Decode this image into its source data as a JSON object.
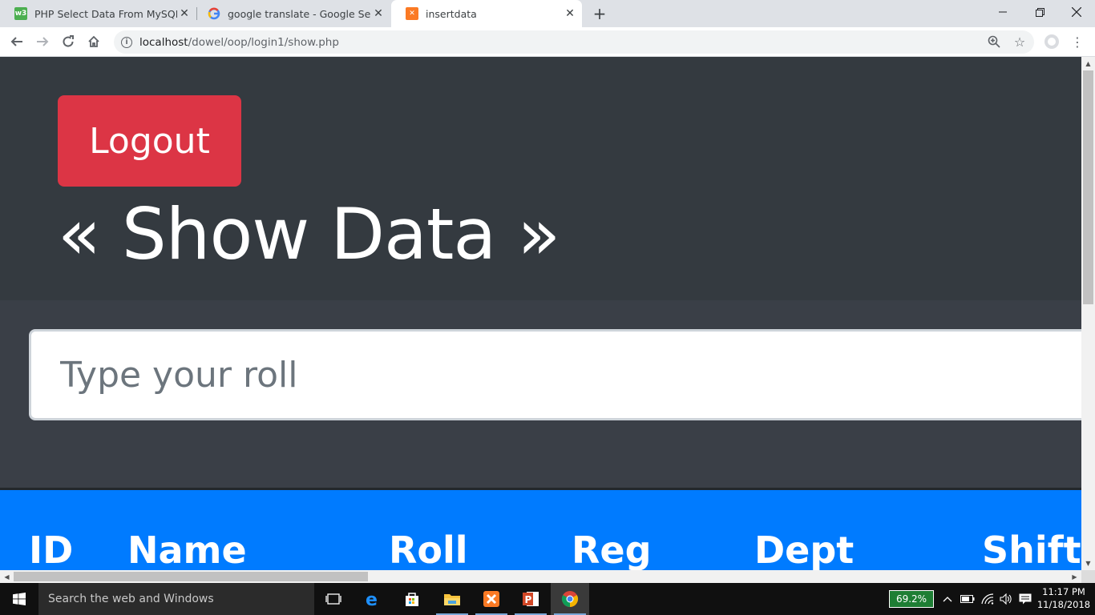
{
  "browser": {
    "tabs": [
      {
        "title": "PHP Select Data From MySQL",
        "favicon": "w3schools-icon",
        "active": false
      },
      {
        "title": "google translate - Google Search",
        "favicon": "google-icon",
        "active": false
      },
      {
        "title": "insertdata",
        "favicon": "xampp-icon",
        "active": true
      }
    ],
    "url_host": "localhost",
    "url_path": "/dowel/oop/login1/show.php"
  },
  "page": {
    "logout_label": "Logout",
    "title": "« Show Data »",
    "search_placeholder": "Type your roll",
    "table_headers": [
      "ID",
      "Name",
      "Roll",
      "Reg",
      "Dept",
      "Shift"
    ],
    "colors": {
      "header_bg": "#343a40",
      "logout_bg": "#dc3545",
      "table_head_bg": "#007bff"
    }
  },
  "taskbar": {
    "search_placeholder": "Search the web and Windows",
    "battery": "69.2%",
    "time": "11:17 PM",
    "date": "11/18/2018"
  }
}
